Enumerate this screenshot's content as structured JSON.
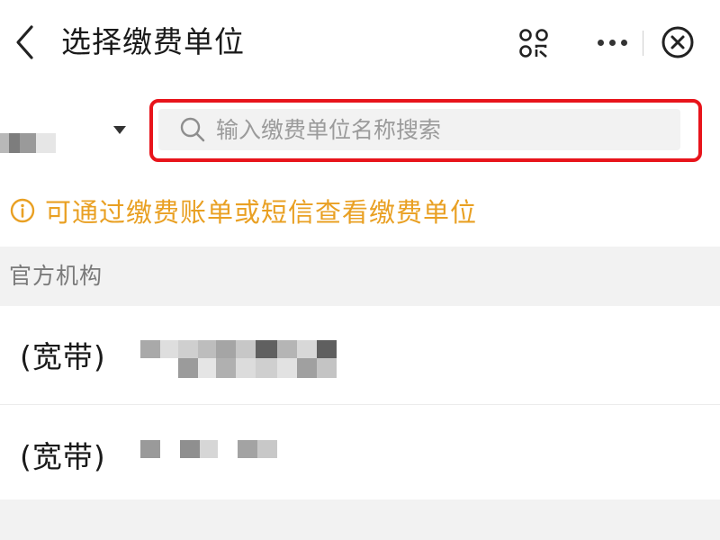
{
  "header": {
    "title": "选择缴费单位",
    "back_icon": "chevron-left-icon",
    "scan_icon": "scan-icon",
    "more_icon": "more-dots-icon",
    "close_icon": "close-circle-icon"
  },
  "search": {
    "region_icon": "caret-down-icon",
    "placeholder": "输入缴费单位名称搜索",
    "icon": "search-icon",
    "highlight_color": "#e8141b"
  },
  "tip": {
    "icon": "info-circle-icon",
    "text": "可通过缴费账单或短信查看缴费单位",
    "color": "#e9a023"
  },
  "section": {
    "label": "官方机构"
  },
  "orgs": [
    {
      "label": "(宽带)"
    },
    {
      "label": "(宽带)"
    }
  ],
  "colors": {
    "background": "#ffffff",
    "section_background": "#f2f2f2",
    "text": "#1a1a1a",
    "muted_text": "#7a7a7a"
  }
}
